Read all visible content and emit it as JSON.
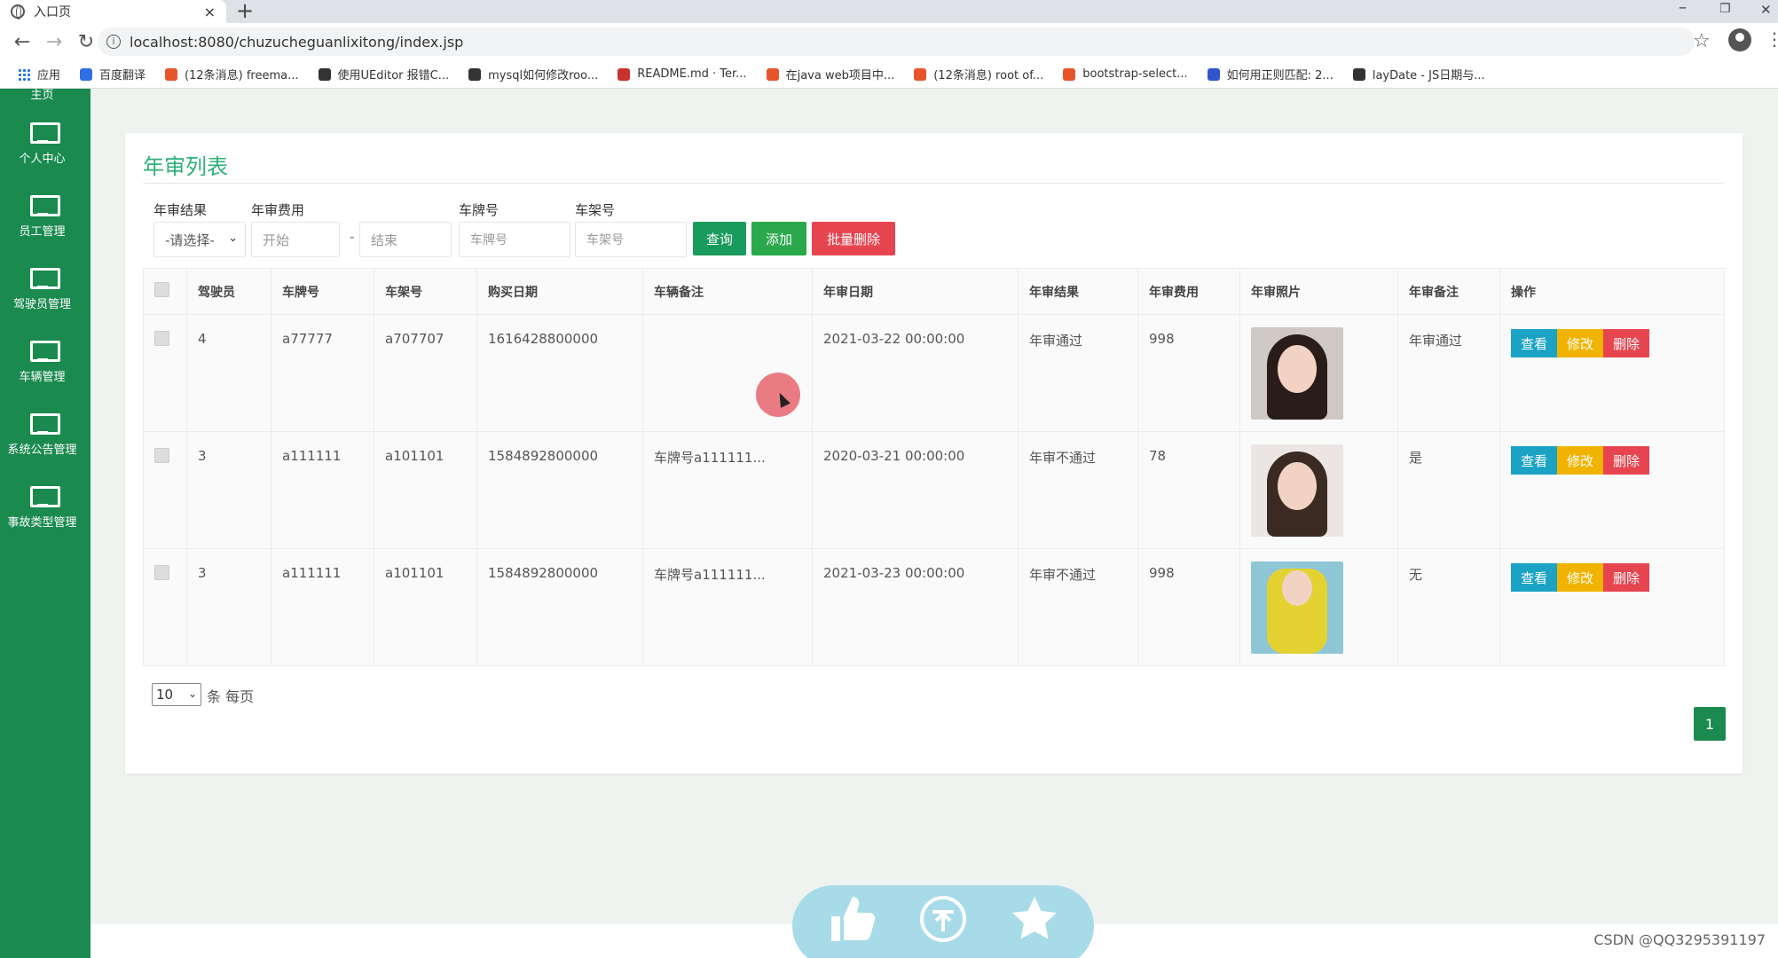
{
  "browser": {
    "tab_title": "入口页",
    "tab_close": "×",
    "new_tab": "+",
    "url": "localhost:8080/chuzucheguanlixitong/index.jsp",
    "nav_back": "←",
    "nav_forward": "→",
    "nav_reload": "↻",
    "star": "☆",
    "menu": "⋮",
    "win_min": "–",
    "win_restore": "❐",
    "win_close": "✕",
    "bookmarks": [
      {
        "label": "应用",
        "color": "#1a73e8"
      },
      {
        "label": "百度翻译",
        "color": "#2e6fe6"
      },
      {
        "label": "(12条消息) freema...",
        "color": "#e8542a"
      },
      {
        "label": "使用UEditor 报错C...",
        "color": "#333333"
      },
      {
        "label": "mysql如何修改roo...",
        "color": "#333333"
      },
      {
        "label": "README.md · Ter...",
        "color": "#c8322c"
      },
      {
        "label": "在java web项目中...",
        "color": "#e8542a"
      },
      {
        "label": "(12条消息) root of...",
        "color": "#e8542a"
      },
      {
        "label": "bootstrap-select...",
        "color": "#e8542a"
      },
      {
        "label": "如何用正则匹配: 2...",
        "color": "#3355cc"
      },
      {
        "label": "layDate - JS日期与...",
        "color": "#333333"
      }
    ]
  },
  "sidebar": {
    "top_label": "主页",
    "items": [
      {
        "label": "个人中心"
      },
      {
        "label": "员工管理"
      },
      {
        "label": "驾驶员管理"
      },
      {
        "label": "车辆管理"
      },
      {
        "label": "系统公告管理"
      },
      {
        "label": "事故类型管理"
      }
    ]
  },
  "panel": {
    "title": "年审列表",
    "filters": {
      "result_label": "年审结果",
      "result_value": "-请选择-",
      "fee_label": "年审费用",
      "fee_start_placeholder": "开始",
      "fee_sep": "-",
      "fee_end_placeholder": "结束",
      "plate_label": "车牌号",
      "plate_placeholder": "车牌号",
      "frame_label": "车架号",
      "frame_placeholder": "车架号"
    },
    "buttons": {
      "search": "查询",
      "add": "添加",
      "batch_delete": "批量删除"
    },
    "columns": [
      "驾驶员",
      "车牌号",
      "车架号",
      "购买日期",
      "车辆备注",
      "年审日期",
      "年审结果",
      "年审费用",
      "年审照片",
      "年审备注",
      "操作"
    ],
    "rows": [
      {
        "driver": "4",
        "plate": "a77777",
        "frame": "a707707",
        "buy_date": "1616428800000",
        "vehicle_note": "",
        "audit_date": "2021-03-22 00:00:00",
        "result": "年审通过",
        "fee": "998",
        "audit_note": "年审通过"
      },
      {
        "driver": "3",
        "plate": "a111111",
        "frame": "a101101",
        "buy_date": "1584892800000",
        "vehicle_note": "车牌号a111111...",
        "audit_date": "2020-03-21 00:00:00",
        "result": "年审不通过",
        "fee": "78",
        "audit_note": "是"
      },
      {
        "driver": "3",
        "plate": "a111111",
        "frame": "a101101",
        "buy_date": "1584892800000",
        "vehicle_note": "车牌号a111111...",
        "audit_date": "2021-03-23 00:00:00",
        "result": "年审不通过",
        "fee": "998",
        "audit_note": "无"
      }
    ],
    "row_actions": {
      "view": "查看",
      "edit": "修改",
      "delete": "删除"
    },
    "pager": {
      "page_size": "10",
      "page_size_suffix": "条 每页",
      "current_page": "1"
    }
  },
  "colors": {
    "sidebar_bg": "#1a8a4f",
    "title_green": "#2db07a",
    "btn_search": "#1a9b5e",
    "btn_add": "#2aa84b",
    "btn_batch_delete": "#e64550",
    "btn_view": "#1ba3c6",
    "btn_edit": "#f0b400",
    "btn_delete": "#e64550"
  },
  "watermark": "CSDN @QQ3295391197"
}
